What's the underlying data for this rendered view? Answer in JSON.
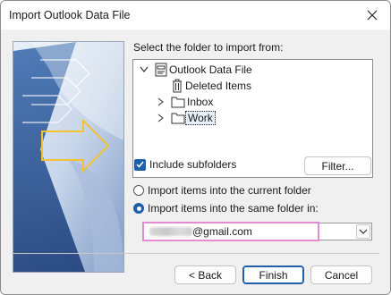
{
  "window": {
    "title": "Import Outlook Data File"
  },
  "instruction": "Select the folder to import from:",
  "tree": {
    "root": "Outlook Data File",
    "items": [
      "Deleted Items",
      "Inbox",
      "Work"
    ],
    "selected": "Work"
  },
  "include_subfolders": {
    "label": "Include subfolders",
    "checked": true
  },
  "filter_button": "Filter...",
  "radio_current": {
    "label": "Import items into the current folder",
    "selected": false
  },
  "radio_same": {
    "label": "Import items into the same folder in:",
    "selected": true
  },
  "combo": {
    "value": "@gmail.com"
  },
  "buttons": {
    "back": "< Back",
    "finish": "Finish",
    "cancel": "Cancel"
  },
  "icons": {
    "close": "close-icon",
    "pst": "outlook-data-file-icon",
    "trash": "deleted-items-icon",
    "folder": "folder-icon",
    "expand": "chevron-right-icon",
    "collapse": "chevron-down-icon",
    "dropdown": "chevron-down-icon"
  },
  "colors": {
    "accent": "#1f5fa8",
    "highlight": "#e58bd3"
  }
}
